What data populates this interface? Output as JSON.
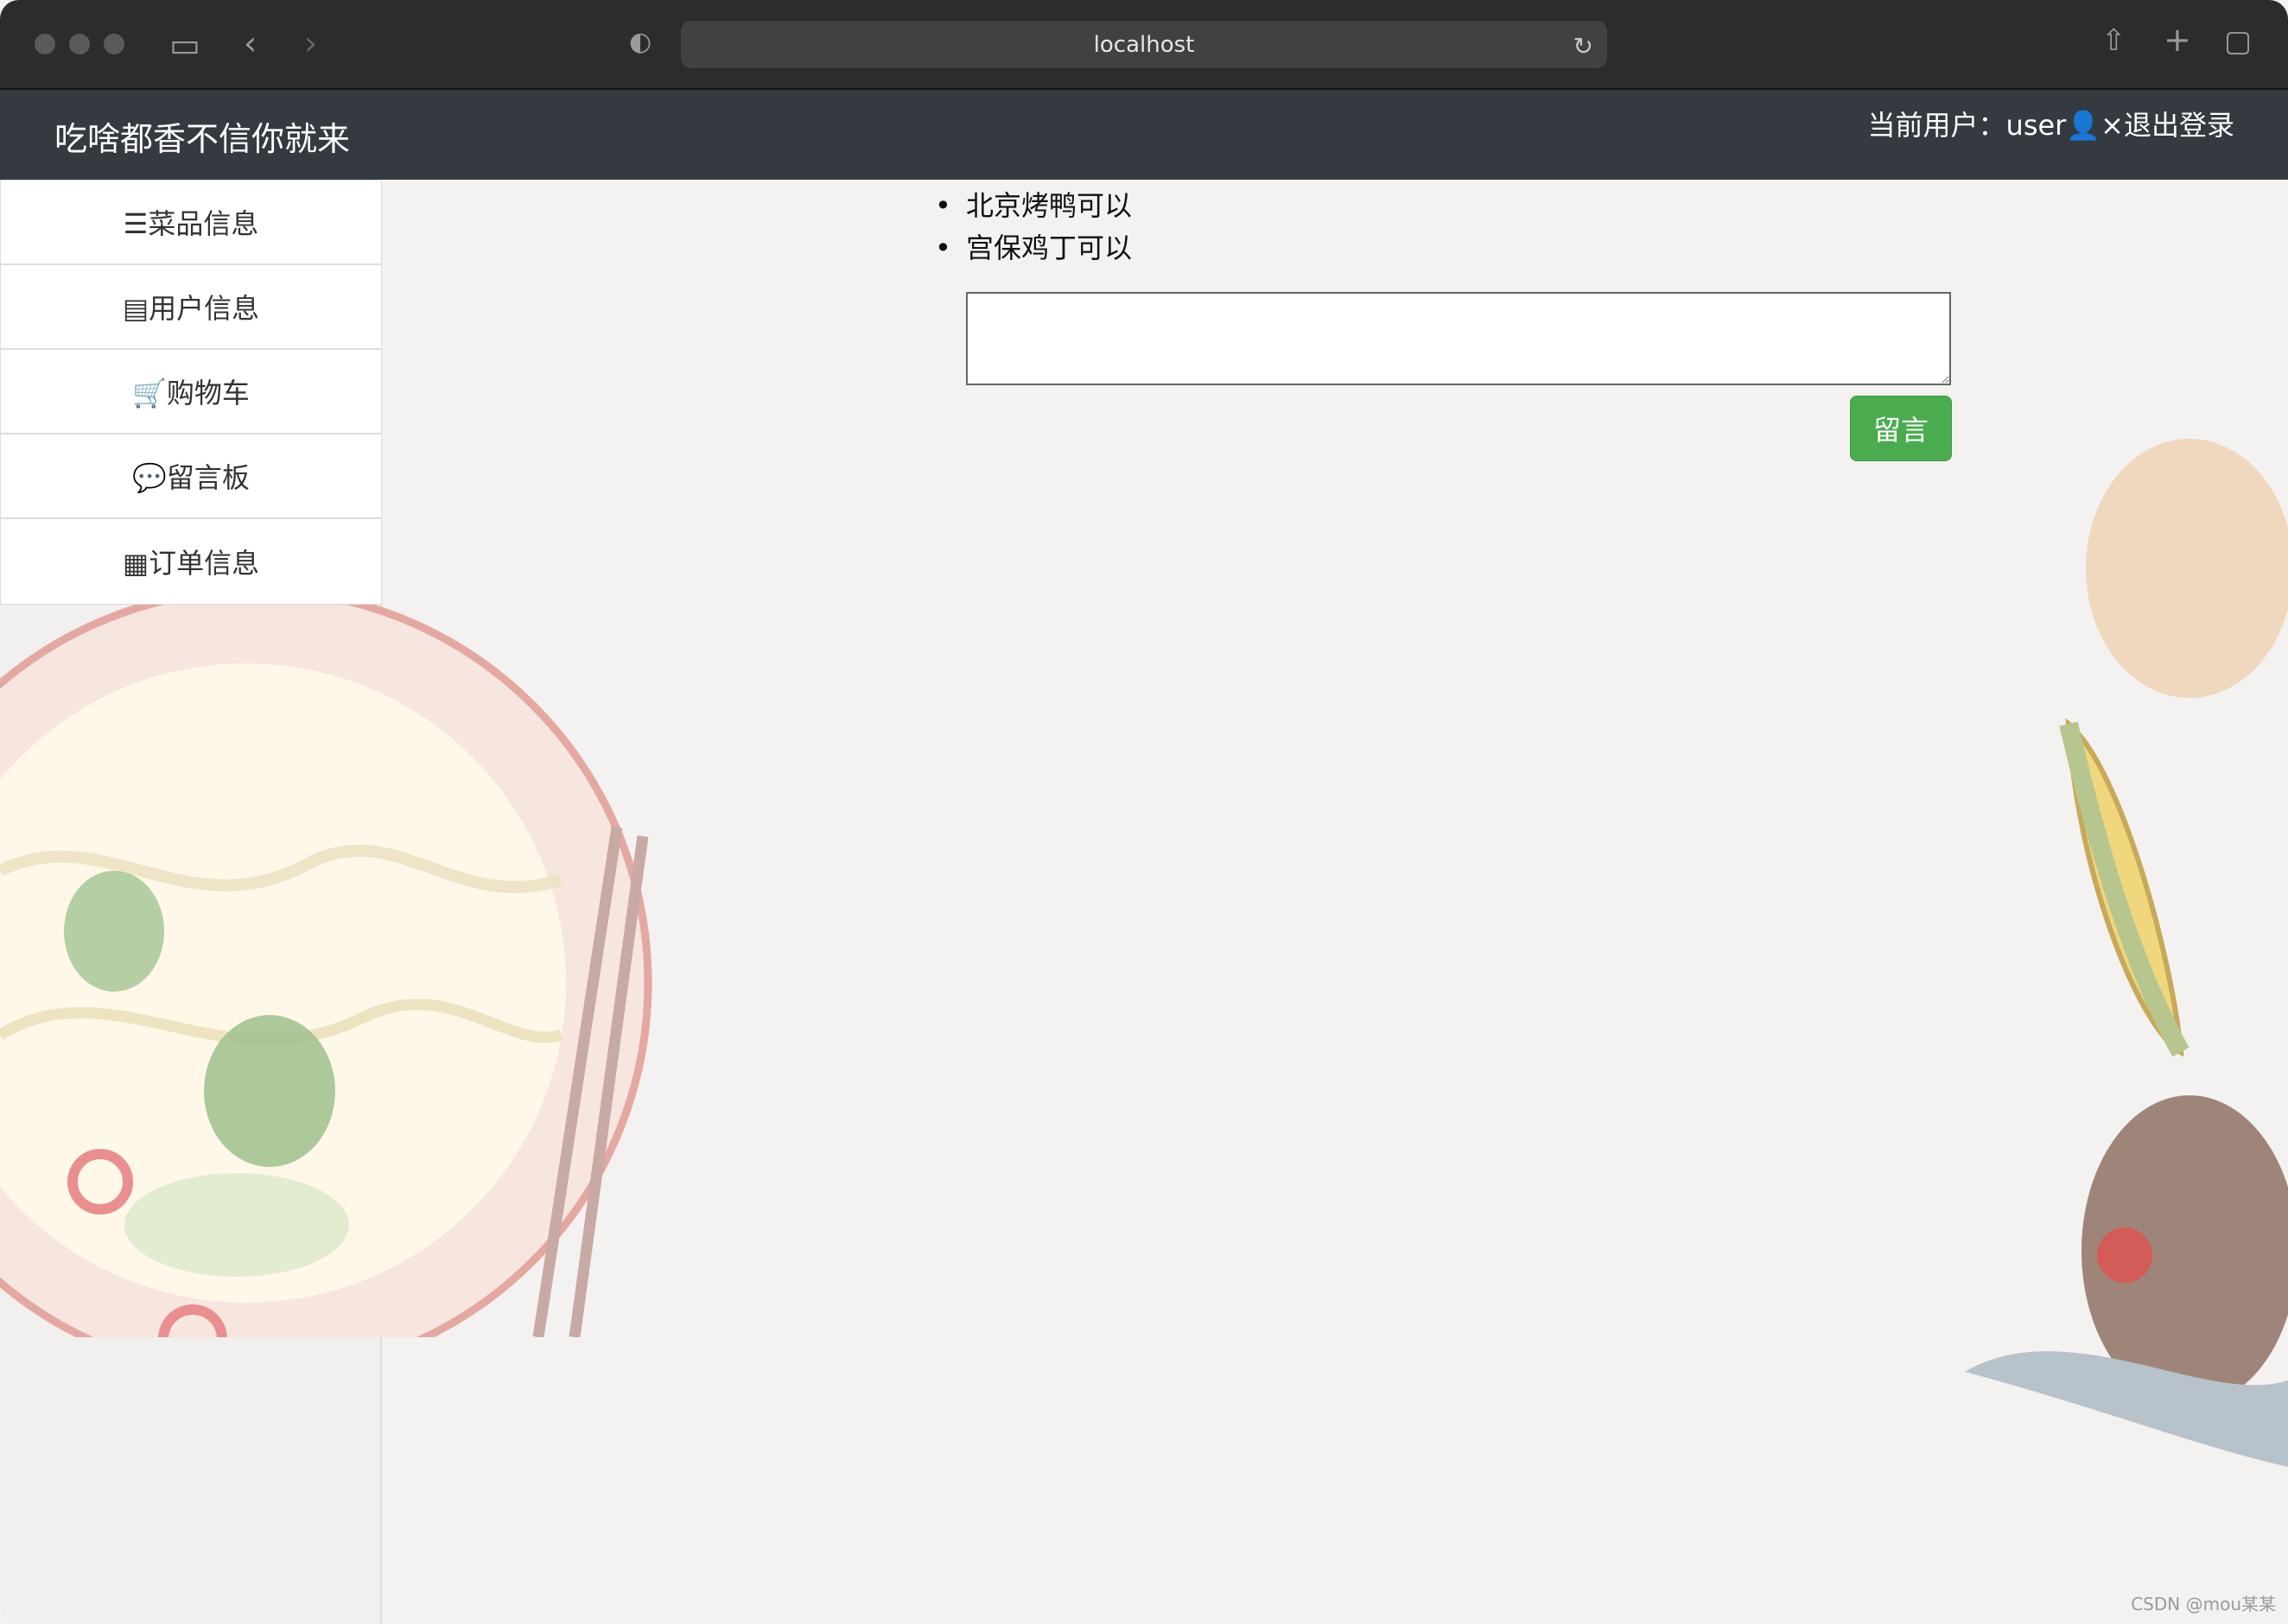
{
  "browser": {
    "url": "localhost"
  },
  "header": {
    "brand": "吃啥都香不信你就来",
    "current_user_label": "当前用户：",
    "username": "user",
    "logout_label": "退出登录"
  },
  "sidebar": {
    "items": [
      {
        "label": "菜品信息",
        "icon": "list-icon"
      },
      {
        "label": "用户信息",
        "icon": "id-card-icon"
      },
      {
        "label": "购物车",
        "icon": "cart-icon"
      },
      {
        "label": "留言板",
        "icon": "comment-icon"
      },
      {
        "label": "订单信息",
        "icon": "order-list-icon"
      }
    ]
  },
  "message_board": {
    "messages": [
      "北京烤鸭可以",
      "宫保鸡丁可以"
    ],
    "textarea_value": "",
    "submit_label": "留言"
  },
  "colors": {
    "header_bg": "#343a40",
    "submit_bg": "#4aac4f"
  },
  "footer": {
    "watermark": "CSDN @mou某某"
  }
}
